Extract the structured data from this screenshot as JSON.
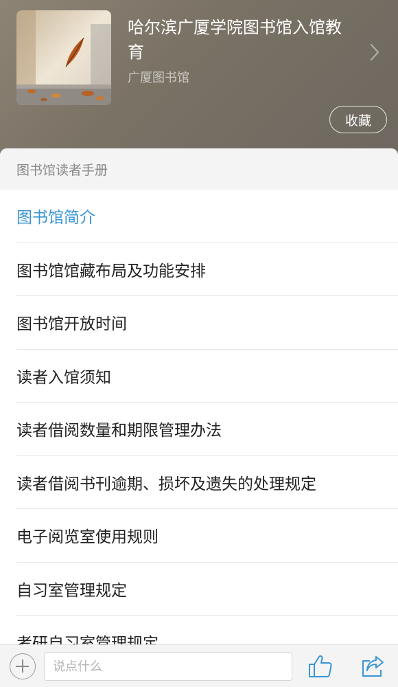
{
  "header": {
    "title": "哈尔滨广厦学院图书馆入馆教育",
    "subtitle": "广厦图书馆",
    "favorite_label": "收藏",
    "chevron_icon": "chevron-right-icon",
    "cover_image": "falling-autumn-leaf-photo"
  },
  "section": {
    "title": "图书馆读者手册"
  },
  "list": {
    "items": [
      {
        "label": "图书馆简介",
        "active": true
      },
      {
        "label": "图书馆馆藏布局及功能安排"
      },
      {
        "label": "图书馆开放时间"
      },
      {
        "label": "读者入馆须知"
      },
      {
        "label": "读者借阅数量和期限管理办法"
      },
      {
        "label": "读者借阅书刊逾期、损坏及遗失的处理规定"
      },
      {
        "label": "电子阅览室使用规则"
      },
      {
        "label": "自习室管理规定"
      },
      {
        "label": "考研自习室管理规定"
      }
    ]
  },
  "bottom_bar": {
    "comment_placeholder": "说点什么",
    "icons": [
      "plus-icon",
      "thumbs-up-icon",
      "share-icon"
    ]
  },
  "colors": {
    "accent": "#3a95d4",
    "header_bg": "#7a7265",
    "section_bg": "#f4f4f5"
  }
}
